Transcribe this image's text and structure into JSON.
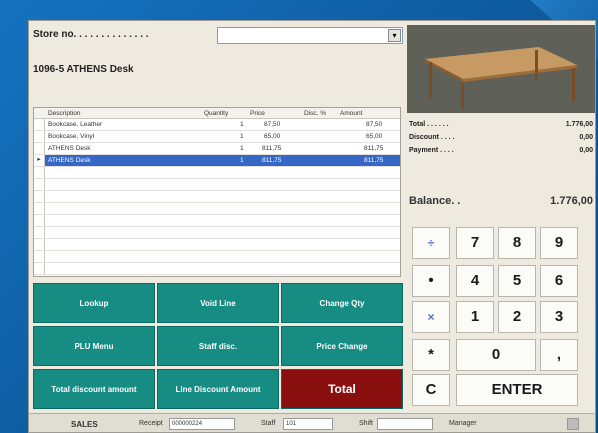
{
  "store": {
    "label": "Store no. . . . . . . . . . . . . .",
    "arrow": "▾"
  },
  "item_title": "1096-5 ATHENS Desk",
  "grid": {
    "columns": [
      "Description",
      "Quantity",
      "Price",
      "Disc. %",
      "Amount"
    ],
    "rows": [
      {
        "marker": "",
        "description": "Bookcase, Leather",
        "quantity": "1",
        "price": "87,50",
        "disc": "",
        "amount": "87,50"
      },
      {
        "marker": "",
        "description": "Bookcase, Vinyl",
        "quantity": "1",
        "price": "65,00",
        "disc": "",
        "amount": "65,00"
      },
      {
        "marker": "",
        "description": "ATHENS Desk",
        "quantity": "1",
        "price": "811,75",
        "disc": "",
        "amount": "811,75"
      },
      {
        "marker": "▸",
        "description": "ATHENS Desk",
        "quantity": "1",
        "price": "811,75",
        "disc": "",
        "amount": "811,75"
      }
    ]
  },
  "summary": {
    "total_label": "Total . . . . . .",
    "total_value": "1.776,00",
    "discount_label": "Discount . . . .",
    "discount_value": "0,00",
    "payment_label": "Payment . . . .",
    "payment_value": "0,00",
    "balance_label": "Balance. .",
    "balance_value": "1.776,00"
  },
  "keypad": {
    "k7": "7",
    "k8": "8",
    "k9": "9",
    "k4": "4",
    "k5": "5",
    "k6": "6",
    "k1": "1",
    "k2": "2",
    "k3": "3",
    "k0": "0",
    "dot": ",",
    "star": "*",
    "clear": "C",
    "enter": "ENTER",
    "div": "÷",
    "bullet": "•",
    "times": "×"
  },
  "functions": {
    "lookup": "Lookup",
    "void_line": "Void Line",
    "change_qty": "Change Qty",
    "plu_menu": "PLU Menu",
    "staff_disc": "Staff disc.",
    "price_change": "Price Change",
    "total_discount": "Total discount amount",
    "line_discount": "Line Discount Amount",
    "total": "Total"
  },
  "status": {
    "mode": "SALES",
    "receipt_label": "Receipt",
    "receipt_value": "000000224",
    "staff_label": "Staff",
    "staff_value": "101",
    "shift_label": "Shift",
    "shift_value": "",
    "role": "Manager"
  },
  "colors": {
    "accent": "#168c83",
    "total_button": "#8a1010",
    "selection": "#3467c6",
    "background": "#0f5fa6"
  }
}
